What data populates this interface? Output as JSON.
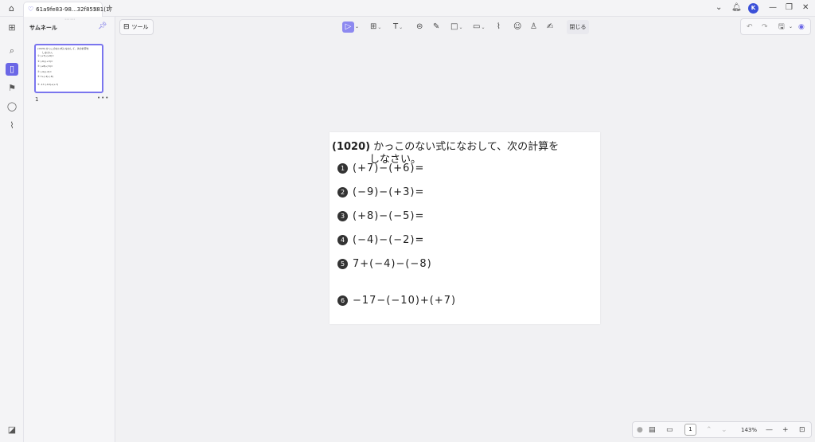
{
  "tab": {
    "title": "61a9fe83-98...32f85581(1)"
  },
  "user": {
    "initial": "K"
  },
  "thumbnails": {
    "title": "サムネール",
    "page_number": "1",
    "preview_lines": [
      "(1020) かっこのない式になおして、次の計算を",
      "　　しなさい。",
      "① (+7)-(+6)=",
      "② (-9)-(+3)=",
      "③ (+8)-(-5)=",
      "④ (-4)-(-2)=",
      "⑤ 7+(-4)-(-8)",
      "⑥ -17-(-10)+(+7)"
    ]
  },
  "toolbar": {
    "tools_label": "ツール",
    "close_label": "閉じる"
  },
  "document": {
    "title_num": "(1020)",
    "title_text": "かっこのない式になおして、次の計算を",
    "title_text2": "しなさい。",
    "problems": [
      {
        "num": "1",
        "expr": "(+7)−(+6)="
      },
      {
        "num": "2",
        "expr": "(−9)−(+3)="
      },
      {
        "num": "3",
        "expr": "(+8)−(−5)="
      },
      {
        "num": "4",
        "expr": "(−4)−(−2)="
      },
      {
        "num": "5",
        "expr": "7+(−4)−(−8)"
      },
      {
        "num": "6",
        "expr": "−17−(−10)+(+7)"
      }
    ]
  },
  "statusbar": {
    "page": "1",
    "zoom": "143%"
  },
  "colors": {
    "accent": "#6b67e6"
  }
}
